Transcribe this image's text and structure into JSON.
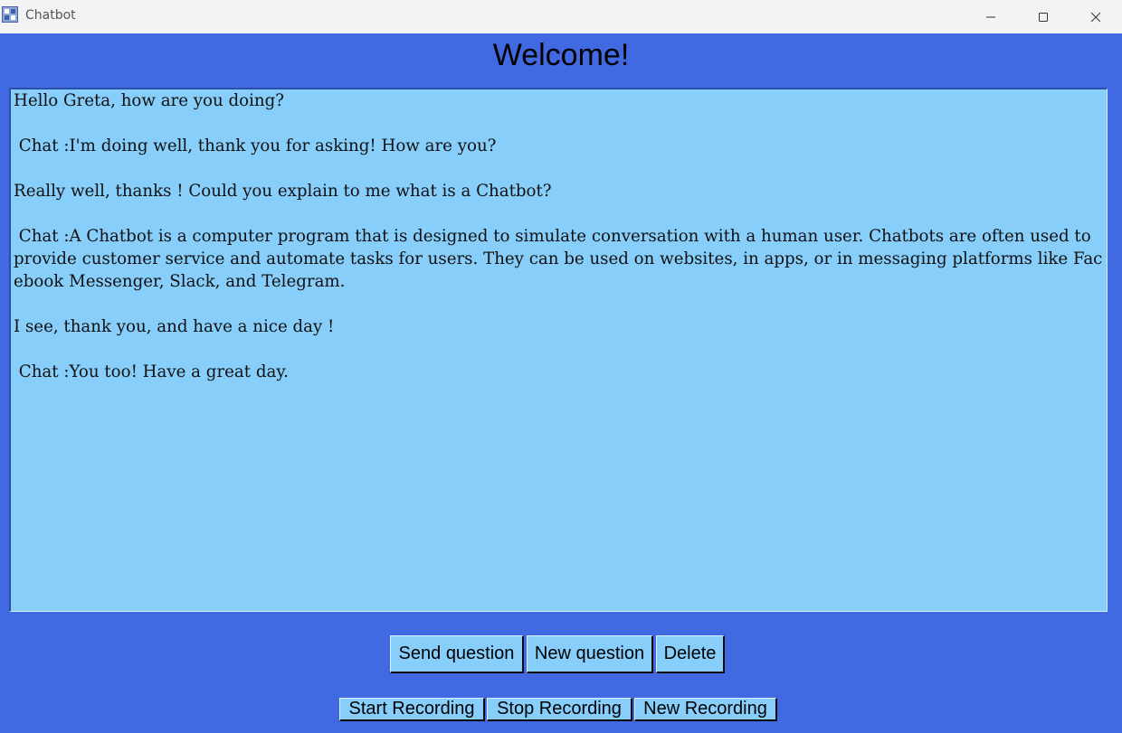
{
  "window": {
    "title": "Chatbot",
    "app_icon": "chatbot-app-icon",
    "controls": [
      "minimize-icon",
      "maximize-icon",
      "close-icon"
    ]
  },
  "header": {
    "title": "Welcome!"
  },
  "chat": {
    "transcript": "Hello Greta, how are you doing?\n\n Chat :I'm doing well, thank you for asking! How are you?\n\nReally well, thanks ! Could you explain to me what is a Chatbot?\n\n Chat :A Chatbot is a computer program that is designed to simulate conversation with a human user. Chatbots are often used to provide customer service and automate tasks for users. They can be used on websites, in apps, or in messaging platforms like Facebook Messenger, Slack, and Telegram.\n\nI see, thank you, and have a nice day !\n\n Chat :You too! Have a great day."
  },
  "buttons": {
    "send_question": "Send question",
    "new_question": "New question",
    "delete": "Delete",
    "start_recording": "Start Recording",
    "stop_recording": "Stop Recording",
    "new_recording": "New Recording"
  },
  "colors": {
    "background": "#4169e1",
    "panel": "#87cefa",
    "titlebar": "#f3f3f3"
  }
}
